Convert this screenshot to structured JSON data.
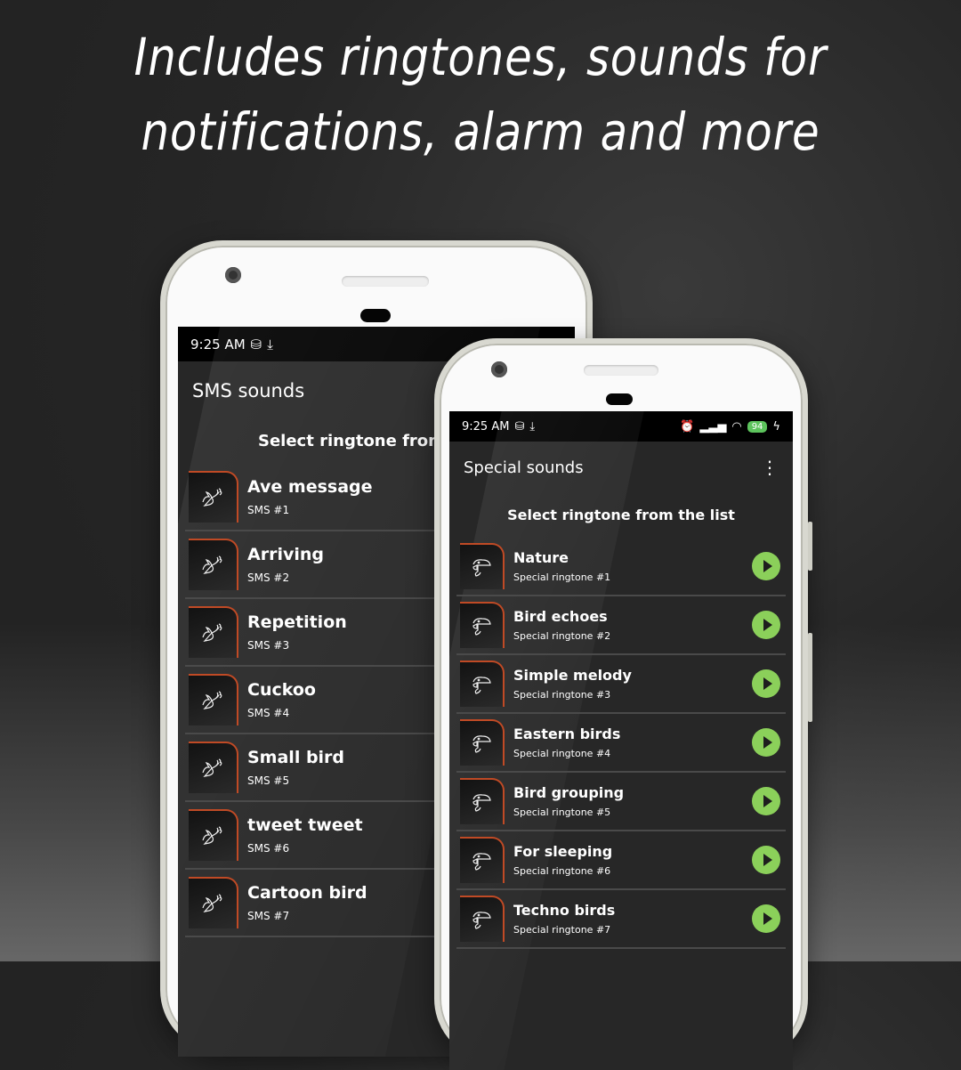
{
  "headline": {
    "line1": "Includes ringtones, sounds for",
    "line2": "notifications, alarm and more"
  },
  "colors": {
    "accent_play": "#8bd05a",
    "thumb_border": "#c04a25",
    "screen_bg": "#272727",
    "battery": "#5cc35c"
  },
  "phone_left": {
    "status": {
      "time": "9:25 AM",
      "icons": [
        "sim-icon",
        "download-icon",
        "alarm-icon"
      ]
    },
    "app_title": "SMS sounds",
    "subtitle": "Select ringtone from",
    "items": [
      {
        "title": "Ave message",
        "sub": "SMS #1",
        "icon": "dove-icon"
      },
      {
        "title": "Arriving",
        "sub": "SMS #2",
        "icon": "dove-icon"
      },
      {
        "title": "Repetition",
        "sub": "SMS #3",
        "icon": "dove-icon"
      },
      {
        "title": "Cuckoo",
        "sub": "SMS #4",
        "icon": "dove-icon"
      },
      {
        "title": "Small bird",
        "sub": "SMS #5",
        "icon": "dove-icon"
      },
      {
        "title": "tweet tweet",
        "sub": "SMS #6",
        "icon": "dove-icon"
      },
      {
        "title": "Cartoon bird",
        "sub": "SMS #7",
        "icon": "dove-icon"
      }
    ]
  },
  "phone_right": {
    "status": {
      "time": "9:25 AM",
      "battery": "94",
      "icons": [
        "sim-icon",
        "download-icon",
        "alarm-icon",
        "signal-icon",
        "wifi-icon",
        "battery-icon",
        "charging-icon"
      ]
    },
    "app_title": "Special sounds",
    "menu_icon": "⋮",
    "subtitle": "Select ringtone from the list",
    "items": [
      {
        "title": "Nature",
        "sub": "Special ringtone #1",
        "icon": "toucan-icon"
      },
      {
        "title": "Bird echoes",
        "sub": "Special ringtone #2",
        "icon": "toucan-icon"
      },
      {
        "title": "Simple melody",
        "sub": "Special ringtone #3",
        "icon": "toucan-icon"
      },
      {
        "title": "Eastern birds",
        "sub": "Special ringtone #4",
        "icon": "toucan-icon"
      },
      {
        "title": "Bird grouping",
        "sub": "Special ringtone #5",
        "icon": "toucan-icon"
      },
      {
        "title": "For sleeping",
        "sub": "Special ringtone #6",
        "icon": "toucan-icon"
      },
      {
        "title": "Techno birds",
        "sub": "Special ringtone #7",
        "icon": "toucan-icon"
      }
    ]
  }
}
